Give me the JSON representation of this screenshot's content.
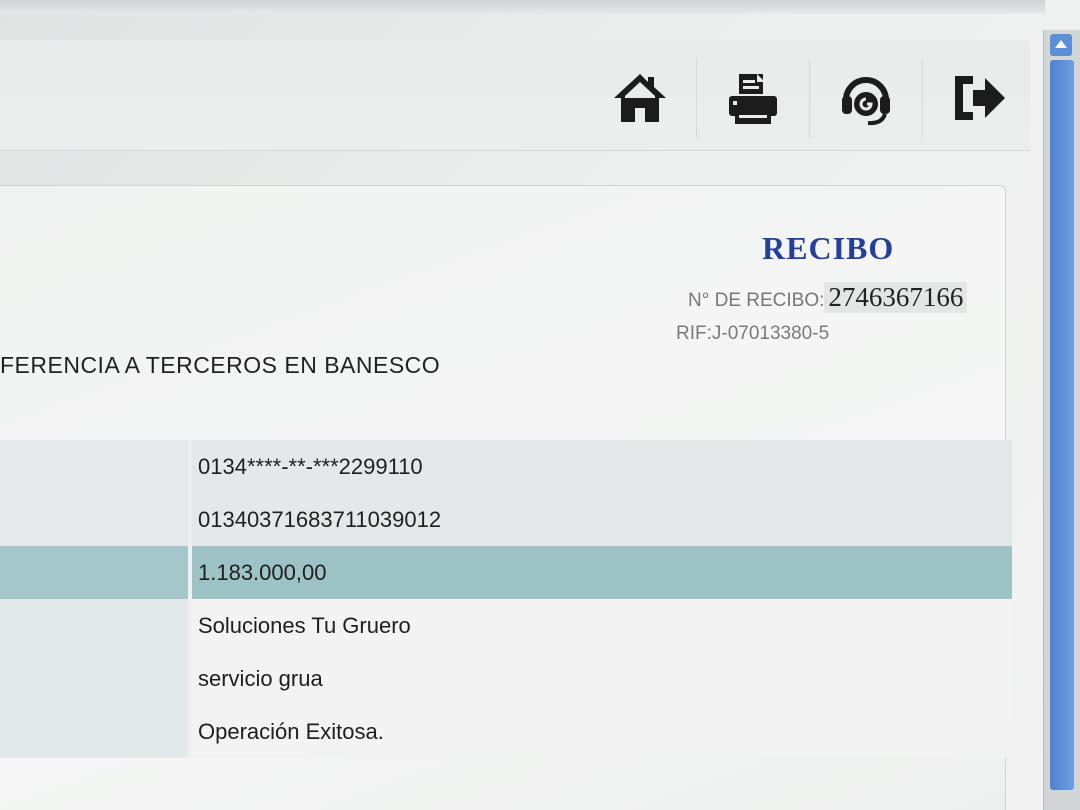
{
  "toolbar": {
    "home_icon": "home-icon",
    "print_icon": "printer-icon",
    "support_icon": "headset-icon",
    "logout_icon": "logout-icon"
  },
  "receipt": {
    "title": "RECIBO",
    "number_label": "N° DE RECIBO:",
    "number_value": "2746367166",
    "rif": "RIF:J-07013380-5",
    "transaction_title": "FERENCIA A TERCEROS EN BANESCO",
    "details": [
      {
        "value": "0134****-**-***2299110"
      },
      {
        "value": "01340371683711039012"
      },
      {
        "value": "1.183.000,00"
      },
      {
        "value": "Soluciones Tu Gruero"
      },
      {
        "value": "servicio grua"
      },
      {
        "value": "Operación Exitosa."
      }
    ]
  },
  "colors": {
    "title_blue": "#24409a",
    "highlight_row": "#9ec3c6",
    "scrollbar_blue": "#5b8fd8"
  }
}
